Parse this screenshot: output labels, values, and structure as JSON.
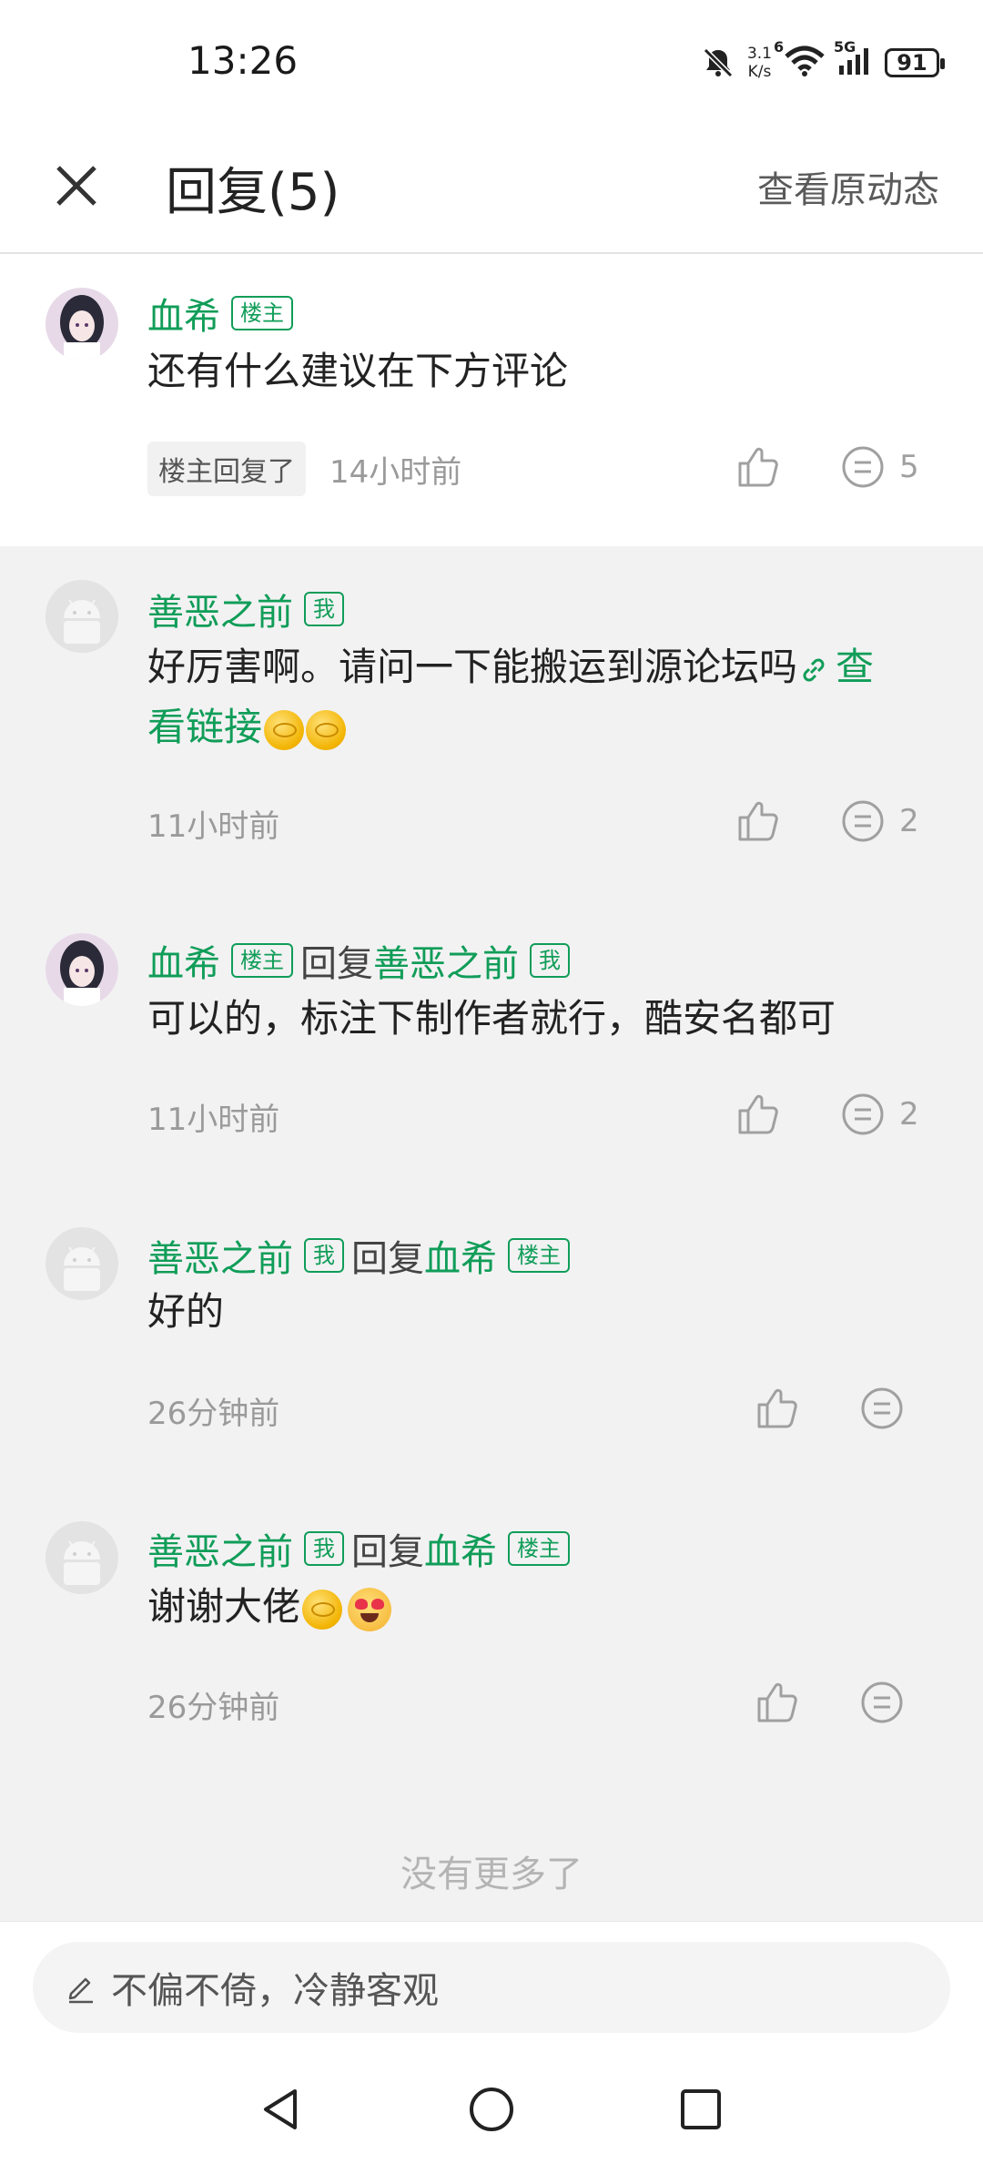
{
  "status_bar": {
    "time": "13:26",
    "net_speed_top": "3.1",
    "net_speed_bottom": "K/s",
    "wifi_label": "6",
    "cell_label": "5G",
    "battery": "91"
  },
  "header": {
    "title": "回复(5)",
    "view_original": "查看原动态"
  },
  "main_post": {
    "author": "血希",
    "author_tag": "楼主",
    "content": "还有什么建议在下方评论",
    "op_replied_label": "楼主回复了",
    "time": "14小时前",
    "comment_count": "5"
  },
  "replies": [
    {
      "author": "善恶之前",
      "author_tag": "我",
      "content": "好厉害啊。请问一下能搬运到源论坛吗",
      "link_text_1": "查",
      "link_text_2": "看链接",
      "time": "11小时前",
      "comment_count": "2"
    },
    {
      "author": "血希",
      "author_tag": "楼主",
      "reply_word": "回复",
      "reply_to": "善恶之前",
      "reply_to_tag": "我",
      "content": "可以的，标注下制作者就行，酷安名都可",
      "time": "11小时前",
      "comment_count": "2"
    },
    {
      "author": "善恶之前",
      "author_tag": "我",
      "reply_word": "回复",
      "reply_to": "血希",
      "reply_to_tag": "楼主",
      "content": "好的",
      "time": "26分钟前"
    },
    {
      "author": "善恶之前",
      "author_tag": "我",
      "reply_word": "回复",
      "reply_to": "血希",
      "reply_to_tag": "楼主",
      "content": "谢谢大佬",
      "time": "26分钟前"
    }
  ],
  "no_more": "没有更多了",
  "input": {
    "placeholder": "不偏不倚，冷静客观"
  },
  "colors": {
    "accent": "#109d58",
    "page_bg": "#f2f2f3"
  }
}
